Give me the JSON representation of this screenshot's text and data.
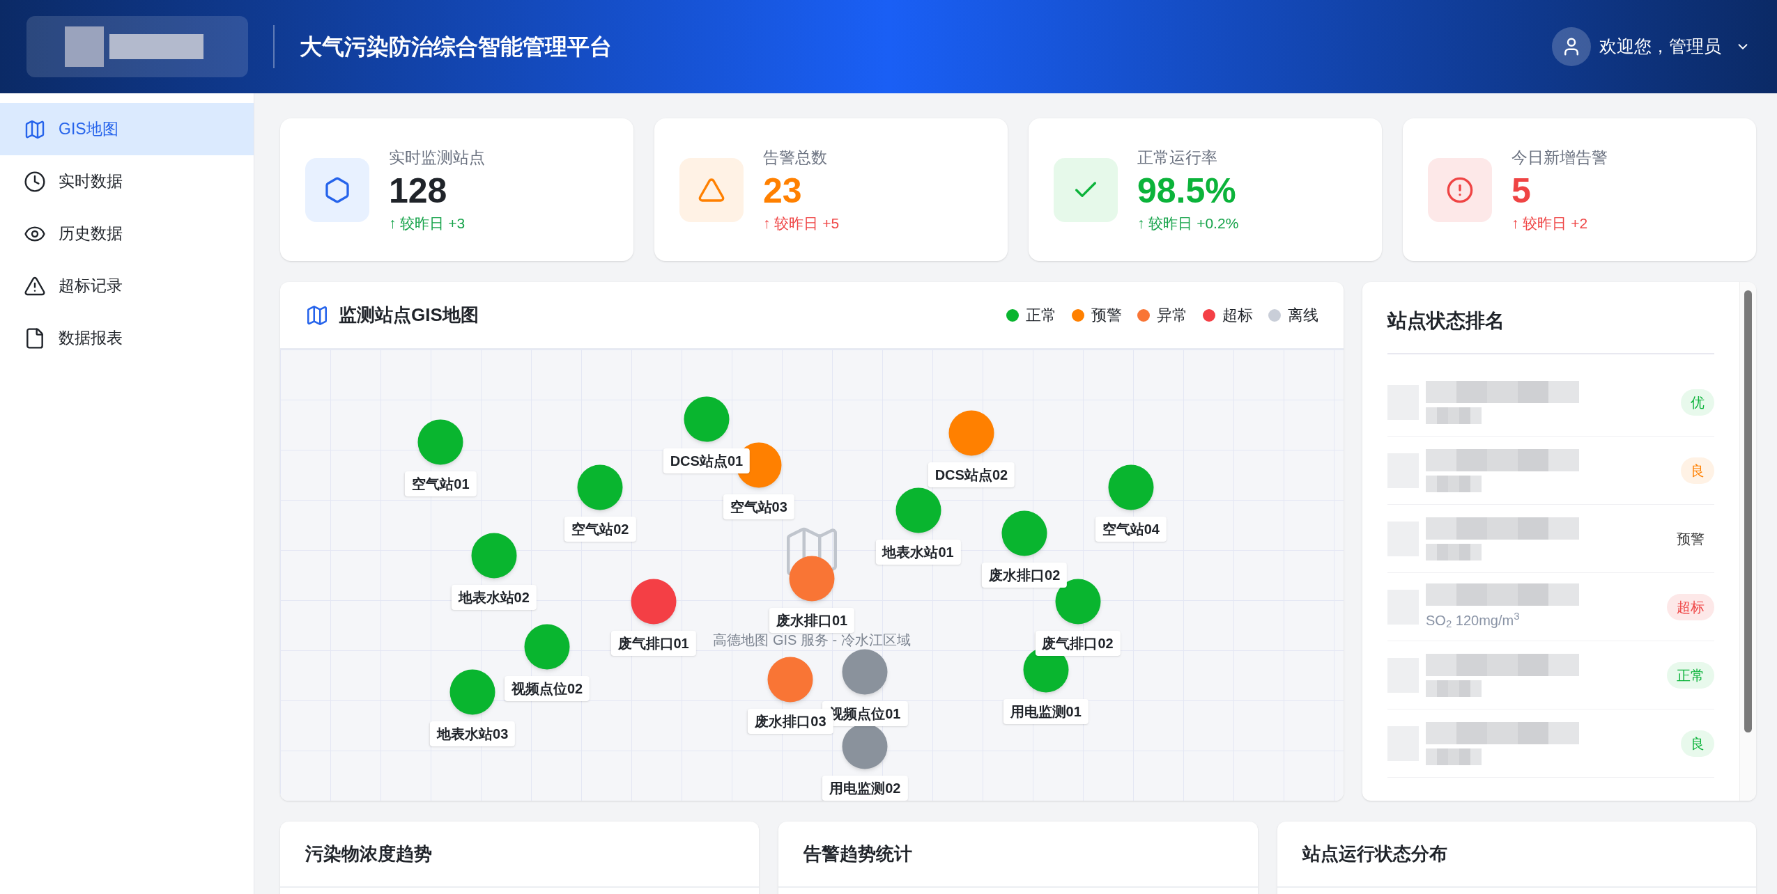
{
  "header": {
    "title": "大气污染防治综合智能管理平台",
    "user": "欢迎您，管理员"
  },
  "sidebar": {
    "items": [
      {
        "label": "GIS地图",
        "selected": true
      },
      {
        "label": "实时数据",
        "selected": false
      },
      {
        "label": "历史数据",
        "selected": false
      },
      {
        "label": "超标记录",
        "selected": false
      },
      {
        "label": "数据报表",
        "selected": false
      }
    ]
  },
  "stats": [
    {
      "label": "实时监测站点",
      "value": "128",
      "kind": "primary",
      "trend": {
        "text": "↑ 较昨日 +3",
        "color": "#16a34a"
      }
    },
    {
      "label": "告警总数",
      "value": "23",
      "kind": "warning",
      "trend": {
        "text": "↑ 较昨日 +5",
        "color": "#ef4444"
      }
    },
    {
      "label": "正常运行率",
      "value": "98.5%",
      "kind": "success",
      "trend": {
        "text": "↑ 较昨日 +0.2%",
        "color": "#16a34a"
      }
    },
    {
      "label": "今日新增告警",
      "value": "5",
      "kind": "danger",
      "trend": {
        "text": "↑ 较昨日 +2",
        "color": "#ef4444"
      }
    }
  ],
  "map": {
    "title": "监测站点GIS地图",
    "legend": [
      {
        "label": "正常",
        "color": "#09b52f"
      },
      {
        "label": "预警",
        "color": "#ff8000"
      },
      {
        "label": "异常",
        "color": "#f97535"
      },
      {
        "label": "超标",
        "color": "#f43f45"
      },
      {
        "label": "离线",
        "color": "#c9ced8"
      }
    ],
    "caption": "高德地图 GIS 服务 - 冷水江区域",
    "stations": [
      {
        "name": "空气站01",
        "color": "#09b52f"
      },
      {
        "name": "DCS站点01",
        "color": "#09b52f"
      },
      {
        "name": "空气站03",
        "color": "#ff8000"
      },
      {
        "name": "DCS站点02",
        "color": "#ff8000"
      },
      {
        "name": "空气站02",
        "color": "#09b52f"
      },
      {
        "name": "空气站04",
        "color": "#09b52f"
      },
      {
        "name": "地表水站01",
        "color": "#09b52f"
      },
      {
        "name": "废水排口02",
        "color": "#09b52f"
      },
      {
        "name": "地表水站02",
        "color": "#09b52f"
      },
      {
        "name": "废水排口01",
        "color": "#f97535"
      },
      {
        "name": "废气排口01",
        "color": "#f43f45"
      },
      {
        "name": "废气排口02",
        "color": "#09b52f"
      },
      {
        "name": "视频点位02",
        "color": "#09b52f"
      },
      {
        "name": "视频点位01",
        "color": "#8a929c"
      },
      {
        "name": "用电监测01",
        "color": "#09b52f"
      },
      {
        "name": "地表水站03",
        "color": "#09b52f"
      },
      {
        "name": "废水排口03",
        "color": "#f97535"
      },
      {
        "name": "用电监测02",
        "color": "#8a929c"
      }
    ]
  },
  "ranking": {
    "title": "站点状态排名",
    "rows": [
      {
        "badge": "优",
        "kind": "success"
      },
      {
        "badge": "良",
        "kind": "warning"
      },
      {
        "badge": "预警",
        "kind": "plain"
      },
      {
        "badge": "超标",
        "kind": "danger",
        "detail": "SO$_{2}$ 120mg/m$^{3}$"
      },
      {
        "badge": "正常",
        "kind": "success"
      },
      {
        "badge": "良",
        "kind": "success"
      }
    ]
  },
  "panels": [
    {
      "title": "污染物浓度趋势"
    },
    {
      "title": "告警趋势统计"
    },
    {
      "title": "站点运行状态分布"
    }
  ]
}
